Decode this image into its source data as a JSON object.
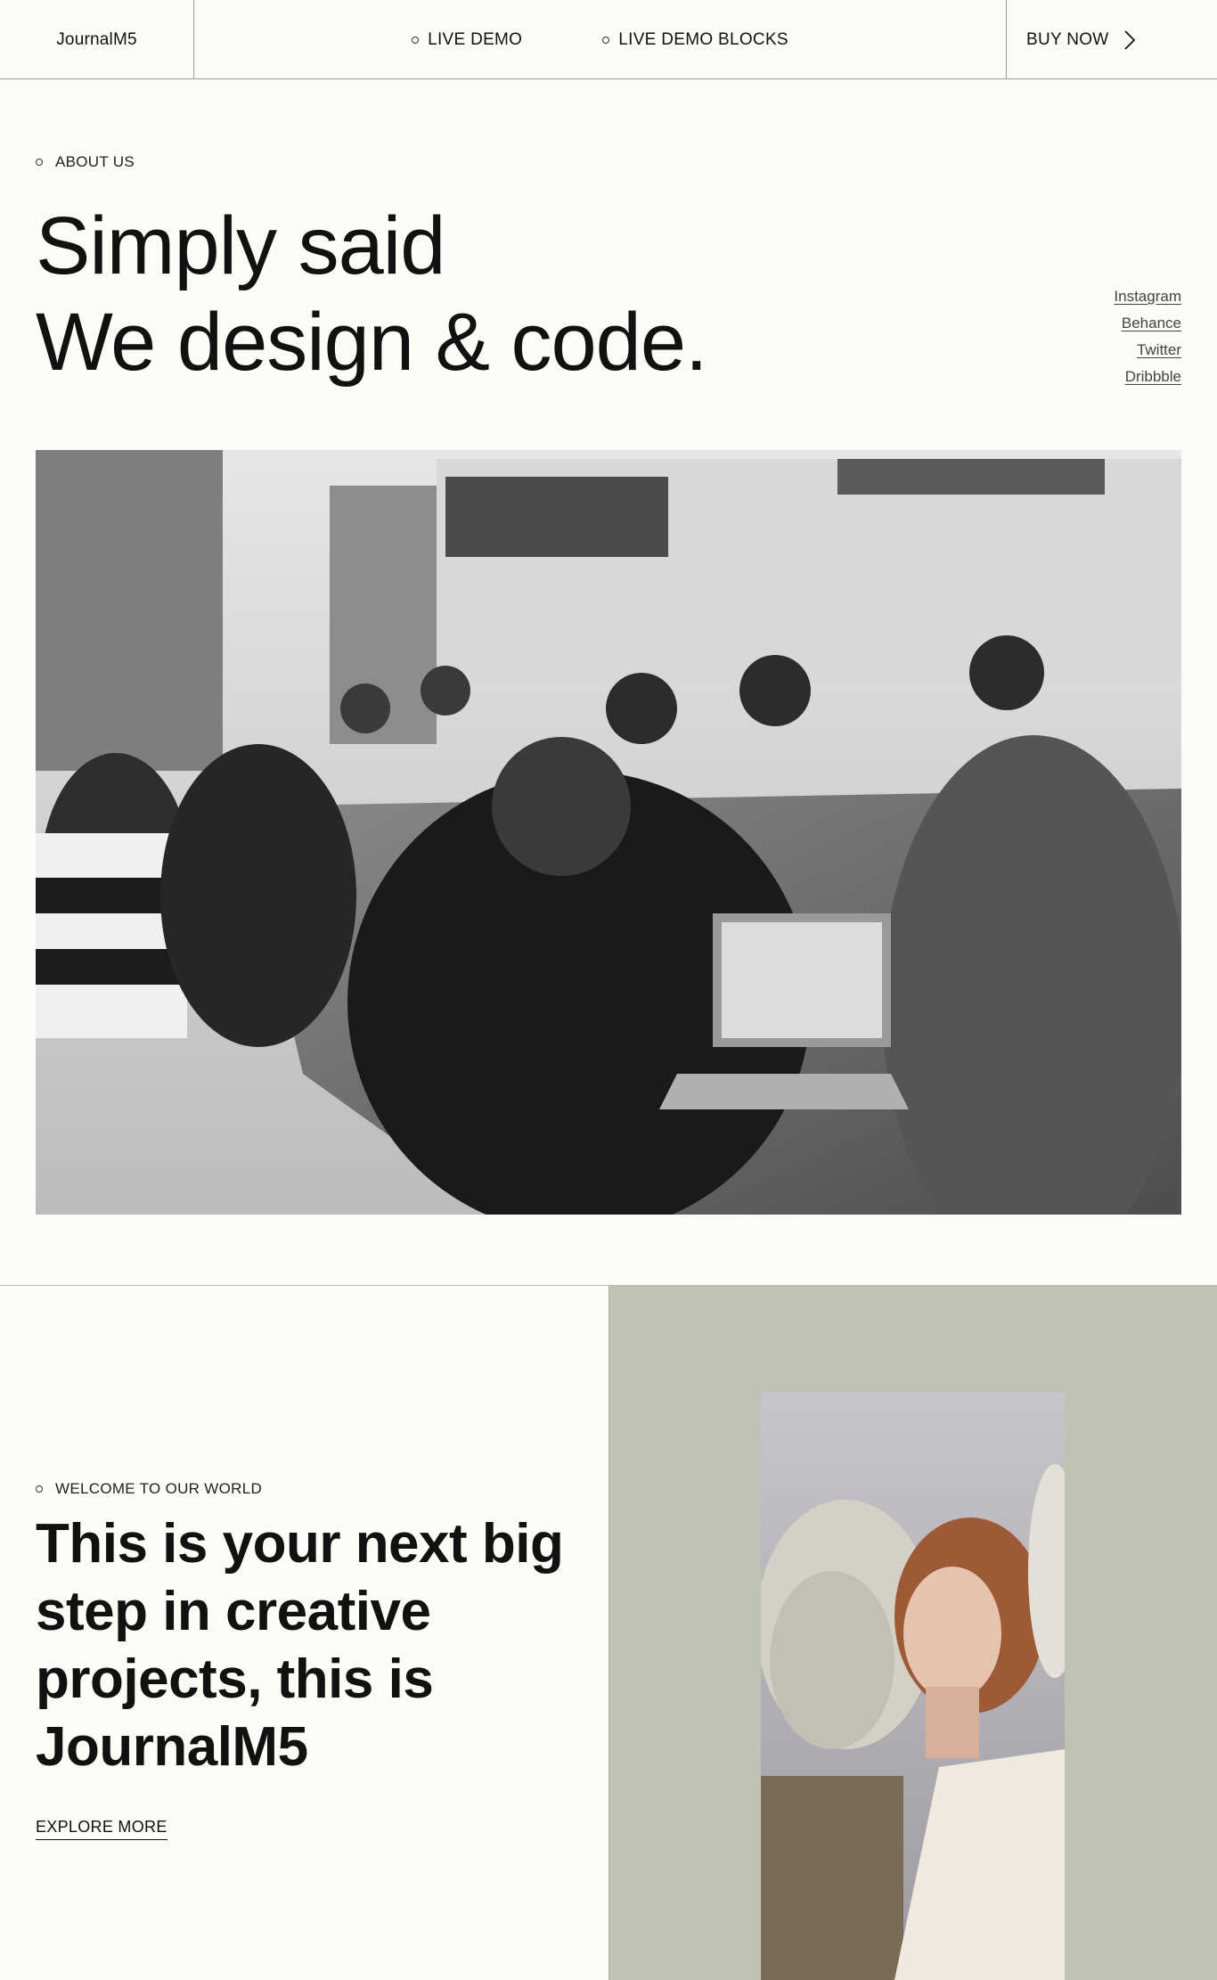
{
  "header": {
    "brand": "JournalM5",
    "nav": [
      {
        "label": "LIVE DEMO"
      },
      {
        "label": "LIVE DEMO BLOCKS"
      }
    ],
    "buy_label": "BUY NOW"
  },
  "hero": {
    "eyebrow": "ABOUT US",
    "title_line1": "Simply said",
    "title_line2": "We design & code.",
    "social": [
      "Instagram",
      "Behance",
      "Twitter",
      "Dribbble"
    ],
    "photo_icon": "meeting-photo"
  },
  "welcome": {
    "eyebrow": "WELCOME TO OUR WORLD",
    "title": "This is your next big step in creative projects, this is JournalM5",
    "explore_label": "EXPLORE MORE",
    "panel_color": "#bec3b4",
    "photo_icon": "portrait-photo"
  }
}
